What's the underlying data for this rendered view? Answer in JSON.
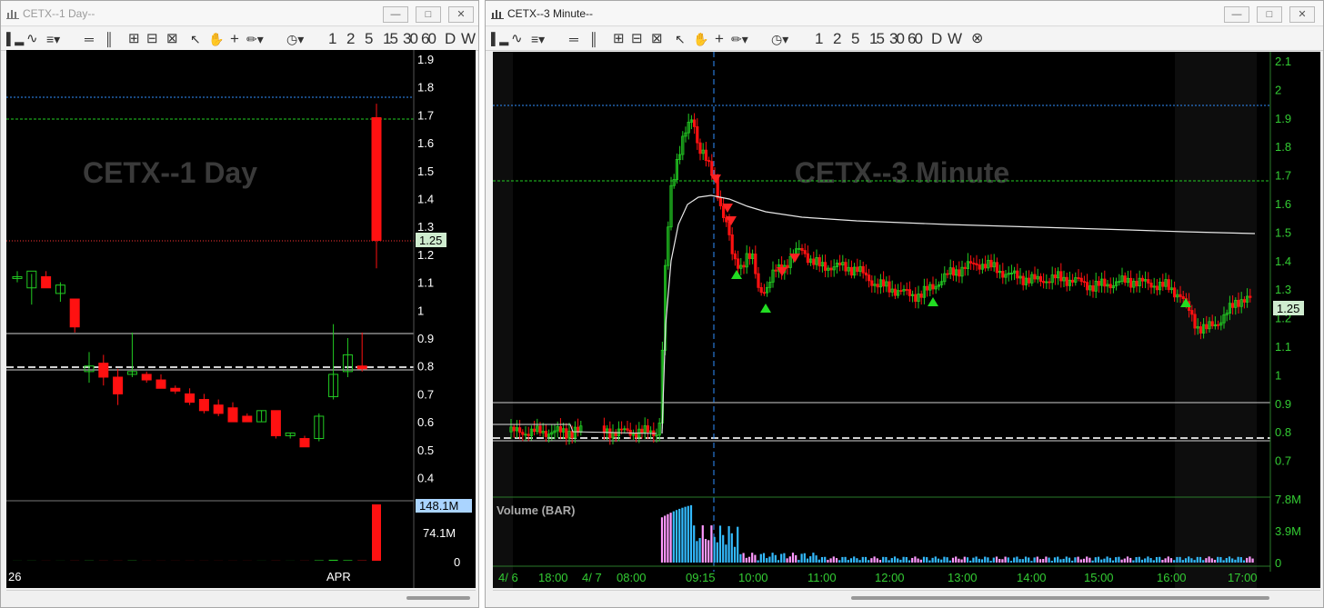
{
  "window1": {
    "title": "CETX--1 Day--",
    "watermark": "CETX--1 Day",
    "timeframe_buttons": [
      "1",
      "2",
      "5",
      "15",
      "30",
      "60",
      "D",
      "W"
    ],
    "price_labels": [
      "1.9",
      "1.8",
      "1.7",
      "1.6",
      "1.5",
      "1.4",
      "1.3",
      "1.2",
      "1.1",
      "1",
      "0.9",
      "0.8",
      "0.7",
      "0.6",
      "0.5",
      "0.4"
    ],
    "last_price": "1.25",
    "volume_labels": [
      "148.1M",
      "74.1M",
      "0"
    ],
    "date_labels": [
      "26",
      "APR"
    ]
  },
  "window2": {
    "title": "CETX--3 Minute--",
    "watermark": "CETX--3 Minute",
    "timeframe_buttons": [
      "1",
      "2",
      "5",
      "15",
      "30",
      "60",
      "D",
      "W"
    ],
    "price_labels": [
      "2.1",
      "2",
      "1.9",
      "1.8",
      "1.7",
      "1.6",
      "1.5",
      "1.4",
      "1.3",
      "1.2",
      "1.1",
      "1",
      "0.9",
      "0.8",
      "0.7"
    ],
    "last_price": "1.25",
    "volume_title": "Volume (BAR)",
    "volume_labels": [
      "7.8M",
      "3.9M",
      "0"
    ],
    "time_labels": [
      "4/ 6",
      "18:00",
      "4/ 7",
      "08:00",
      "09:15",
      "10:00",
      "11:00",
      "12:00",
      "13:00",
      "14:00",
      "15:00",
      "16:00",
      "17:00"
    ]
  },
  "colors": {
    "up": "#22cc22",
    "down": "#ff1111",
    "blue_line": "#2f8fff",
    "green_line": "#22cc22",
    "volume_blue": "#33bbff",
    "volume_pink": "#ff99ff",
    "axis_green": "#33cc33"
  }
}
